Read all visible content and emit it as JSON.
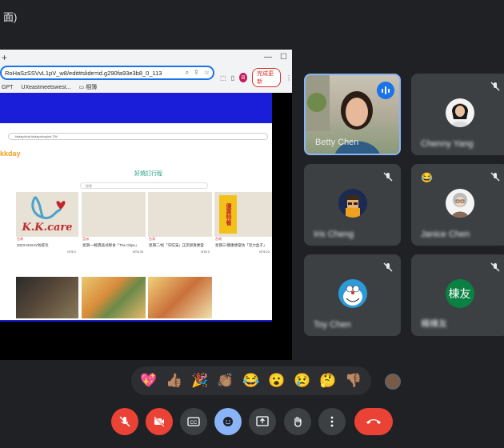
{
  "topbar": {
    "title": "面)"
  },
  "browser": {
    "url": "RoHaSzSSVvL1pV_w8/edit#slide=id.g290fa93e3b8_0_113",
    "update_label": "完成更新",
    "profile_initial": "B",
    "bookmarks": [
      "GPT",
      "UXeastmeetswest...",
      "相簿"
    ]
  },
  "webpage": {
    "url": "kkday/club.kkday.shop/ch-TW",
    "logo": "kkday",
    "section_title": "好燒訂行程",
    "search_placeholder": "搜尋",
    "cards": [
      {
        "brand": "K.K.care",
        "tag": "台灣",
        "caption": "2023 KKDAY防疫包",
        "price": "NT$ 0"
      },
      {
        "tag": "亞洲",
        "caption": "星期一/經典美式輕食「The chips」",
        "price": "NT$ 30"
      },
      {
        "tag": "台灣",
        "caption": "星期二/松「牙旺滿」正宗卵香便當",
        "price": "NT$ 0"
      },
      {
        "badge": "優惠特餐",
        "tag": "台灣",
        "caption": "星期三/健康便當坊「活力盒子」",
        "price": "NT$ 22"
      }
    ]
  },
  "participants": [
    {
      "name": "Betty Chen",
      "speaking": true
    },
    {
      "name": "Chenny Yang",
      "muted": true
    },
    {
      "name": "Iris Cheng",
      "muted": true
    },
    {
      "name": "Janice Chen",
      "muted": true,
      "reaction": "😂"
    },
    {
      "name": "Toy Chen",
      "muted": true
    },
    {
      "name": "楊棟友",
      "initials": "棟友",
      "muted": true,
      "avatar_color": "#0b8043"
    }
  ],
  "reactions": [
    "💖",
    "👍🏽",
    "🎉",
    "👏🏽",
    "😂",
    "😮",
    "😢",
    "🤔",
    "👎🏽"
  ],
  "controls": [
    "mic-off",
    "camera-off",
    "captions",
    "reactions",
    "present",
    "raise-hand",
    "more",
    "leave-call"
  ],
  "colors": {
    "red": "#ea4335",
    "grey": "#3c4043",
    "blue": "#8ab4f8",
    "accent": "#1a73e8"
  }
}
